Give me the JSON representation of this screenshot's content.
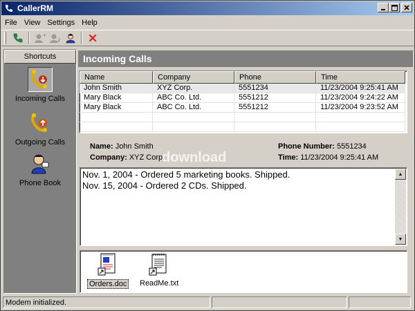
{
  "window": {
    "title": "CallerRM"
  },
  "menu": [
    "File",
    "View",
    "Settings",
    "Help"
  ],
  "toolbar": {
    "icons": [
      "phone-icon",
      "contact-add-icon",
      "contact-link-icon",
      "person-icon",
      "delete-icon"
    ]
  },
  "shortcuts": {
    "header": "Shortcuts",
    "items": [
      {
        "label": "Incoming Calls",
        "icon": "incoming-call-icon",
        "selected": true
      },
      {
        "label": "Outgoing Calls",
        "icon": "outgoing-call-icon",
        "selected": false
      },
      {
        "label": "Phone Book",
        "icon": "phone-book-icon",
        "selected": false
      }
    ]
  },
  "main": {
    "title": "Incoming Calls"
  },
  "calls": {
    "columns": [
      "Name",
      "Company",
      "Phone",
      "Time"
    ],
    "rows": [
      [
        "John Smith",
        "XYZ Corp.",
        "5551234",
        "11/23/2004 9:25:41 AM"
      ],
      [
        "Mary Black",
        "ABC Co. Ltd.",
        "5551212",
        "11/23/2004 9:24:22 AM"
      ],
      [
        "Mary Black",
        "ABC Co. Ltd.",
        "5551212",
        "11/23/2004 9:23:52 AM"
      ]
    ],
    "selected_index": 0
  },
  "details": {
    "name_label": "Name:",
    "name_value": "John Smith",
    "company_label": "Company:",
    "company_value": "XYZ Corp.",
    "phone_label": "Phone Number:",
    "phone_value": "5551234",
    "time_label": "Time:",
    "time_value": "11/23/2004 9:25:41 AM",
    "watermark": "download"
  },
  "notes": [
    "Nov. 1, 2004 - Ordered 5 marketing books. Shipped.",
    "Nov. 15, 2004 - Ordered 2 CDs. Shipped."
  ],
  "attachments": [
    {
      "label": "Orders.doc",
      "icon": "word-document-icon",
      "selected": true
    },
    {
      "label": "ReadMe.txt",
      "icon": "text-document-icon",
      "selected": false
    }
  ],
  "status": {
    "message": "Modem initialized."
  },
  "colors": {
    "title_start": "#0a246a",
    "title_end": "#a6caf0",
    "panel_gray": "#808080",
    "face": "#d4d0c8"
  }
}
